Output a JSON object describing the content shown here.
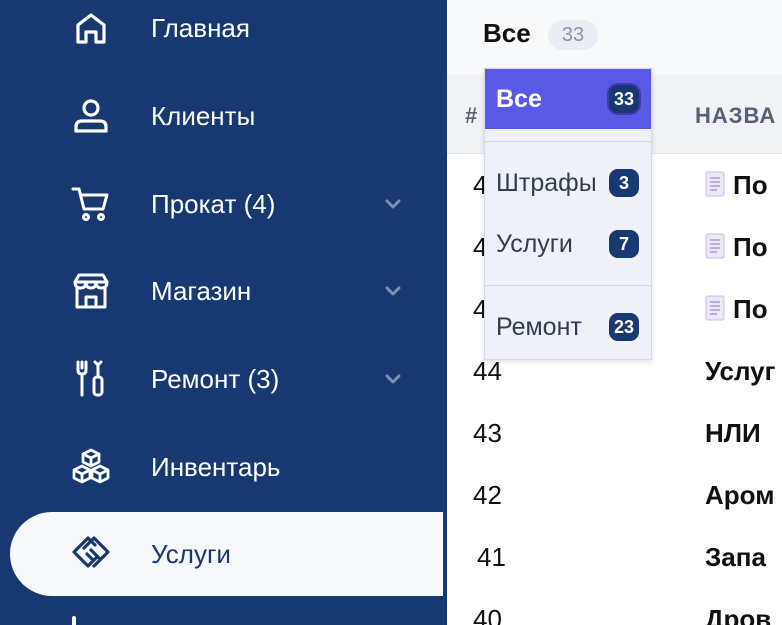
{
  "sidebar": {
    "items": [
      {
        "label": "Главная",
        "icon": "home-icon",
        "has_chevron": false
      },
      {
        "label": "Клиенты",
        "icon": "user-icon",
        "has_chevron": false
      },
      {
        "label": "Прокат (4)",
        "icon": "cart-icon",
        "has_chevron": true
      },
      {
        "label": "Магазин",
        "icon": "store-icon",
        "has_chevron": true
      },
      {
        "label": "Ремонт (3)",
        "icon": "tools-icon",
        "has_chevron": true
      },
      {
        "label": "Инвентарь",
        "icon": "boxes-icon",
        "has_chevron": false
      },
      {
        "label": "Услуги",
        "icon": "handshake-icon",
        "has_chevron": false,
        "active": true
      }
    ]
  },
  "filter": {
    "label": "Все",
    "count": "33"
  },
  "table": {
    "headers": {
      "num": "#",
      "name": "НАЗВА"
    },
    "rows": [
      {
        "id": "4",
        "name": "По",
        "doc_icon": true
      },
      {
        "id": "4",
        "name": "По",
        "doc_icon": true
      },
      {
        "id": "4",
        "name": "По",
        "doc_icon": true
      },
      {
        "id": "44",
        "name": "Услуг",
        "doc_icon": false
      },
      {
        "id": "43",
        "name": "НЛИ",
        "doc_icon": false
      },
      {
        "id": "42",
        "name": "Аром",
        "doc_icon": false
      },
      {
        "id": "41",
        "name": "Запа",
        "doc_icon": false
      },
      {
        "id": "40",
        "name": "Дров",
        "doc_icon": false
      }
    ]
  },
  "dropdown": {
    "items": [
      {
        "label": "Все",
        "count": "33",
        "selected": true
      },
      {
        "label": "Штрафы",
        "count": "3"
      },
      {
        "label": "Услуги",
        "count": "7"
      },
      {
        "label": "Ремонт",
        "count": "23"
      }
    ]
  },
  "colors": {
    "sidebar_bg": "#183871",
    "accent": "#5a59e6",
    "badge": "#183871"
  }
}
